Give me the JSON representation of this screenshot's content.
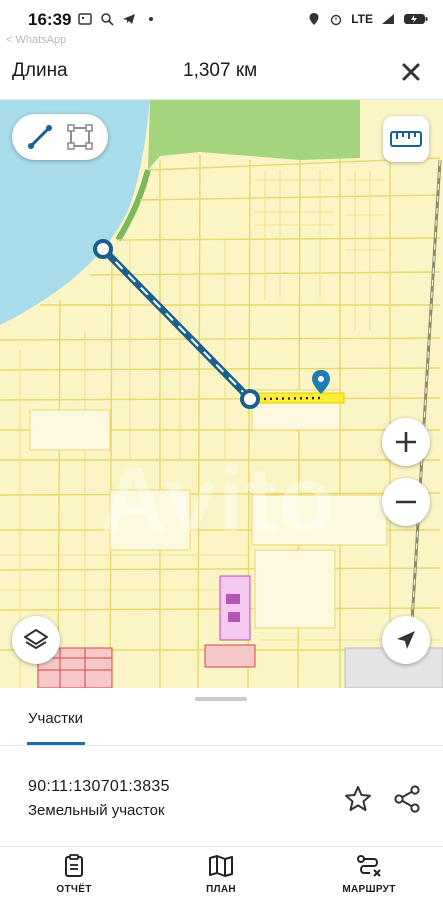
{
  "status_bar": {
    "time": "16:39",
    "ghost_text": "< WhatsApp",
    "network": "LTE",
    "icons": [
      "gallery-icon",
      "search-icon",
      "telegram-icon",
      "dot-icon",
      "location-icon",
      "alarm-icon",
      "wifi-icon",
      "battery-icon"
    ]
  },
  "header": {
    "title": "Длина",
    "value": "1,307 км",
    "close_icon": "close-icon"
  },
  "map": {
    "watermark": "Avito",
    "colors": {
      "parcel_fill": "#fbf5c6",
      "parcel_line": "#e8d66a",
      "water": "#a9dcea",
      "forest": "#a5d47f",
      "measure_line": "#1b5f8c",
      "highlight": "#ffee33"
    },
    "controls": {
      "line_tool": "line-measure-icon",
      "area_tool": "area-measure-icon",
      "ruler": "ruler-icon",
      "zoom_in": "plus-icon",
      "zoom_out": "minus-icon",
      "layers": "layers-icon",
      "locate": "navigation-arrow-icon"
    }
  },
  "sheet": {
    "tab_label": "Участки",
    "cadastral_number": "90:11:130701:3835",
    "parcel_type": "Земельный участок",
    "actions": [
      "star-icon",
      "share-icon"
    ]
  },
  "bottom_nav": [
    {
      "label": "ОТЧЁТ",
      "icon": "report-icon"
    },
    {
      "label": "ПЛАН",
      "icon": "map-plan-icon"
    },
    {
      "label": "МАРШРУТ",
      "icon": "route-icon"
    }
  ]
}
